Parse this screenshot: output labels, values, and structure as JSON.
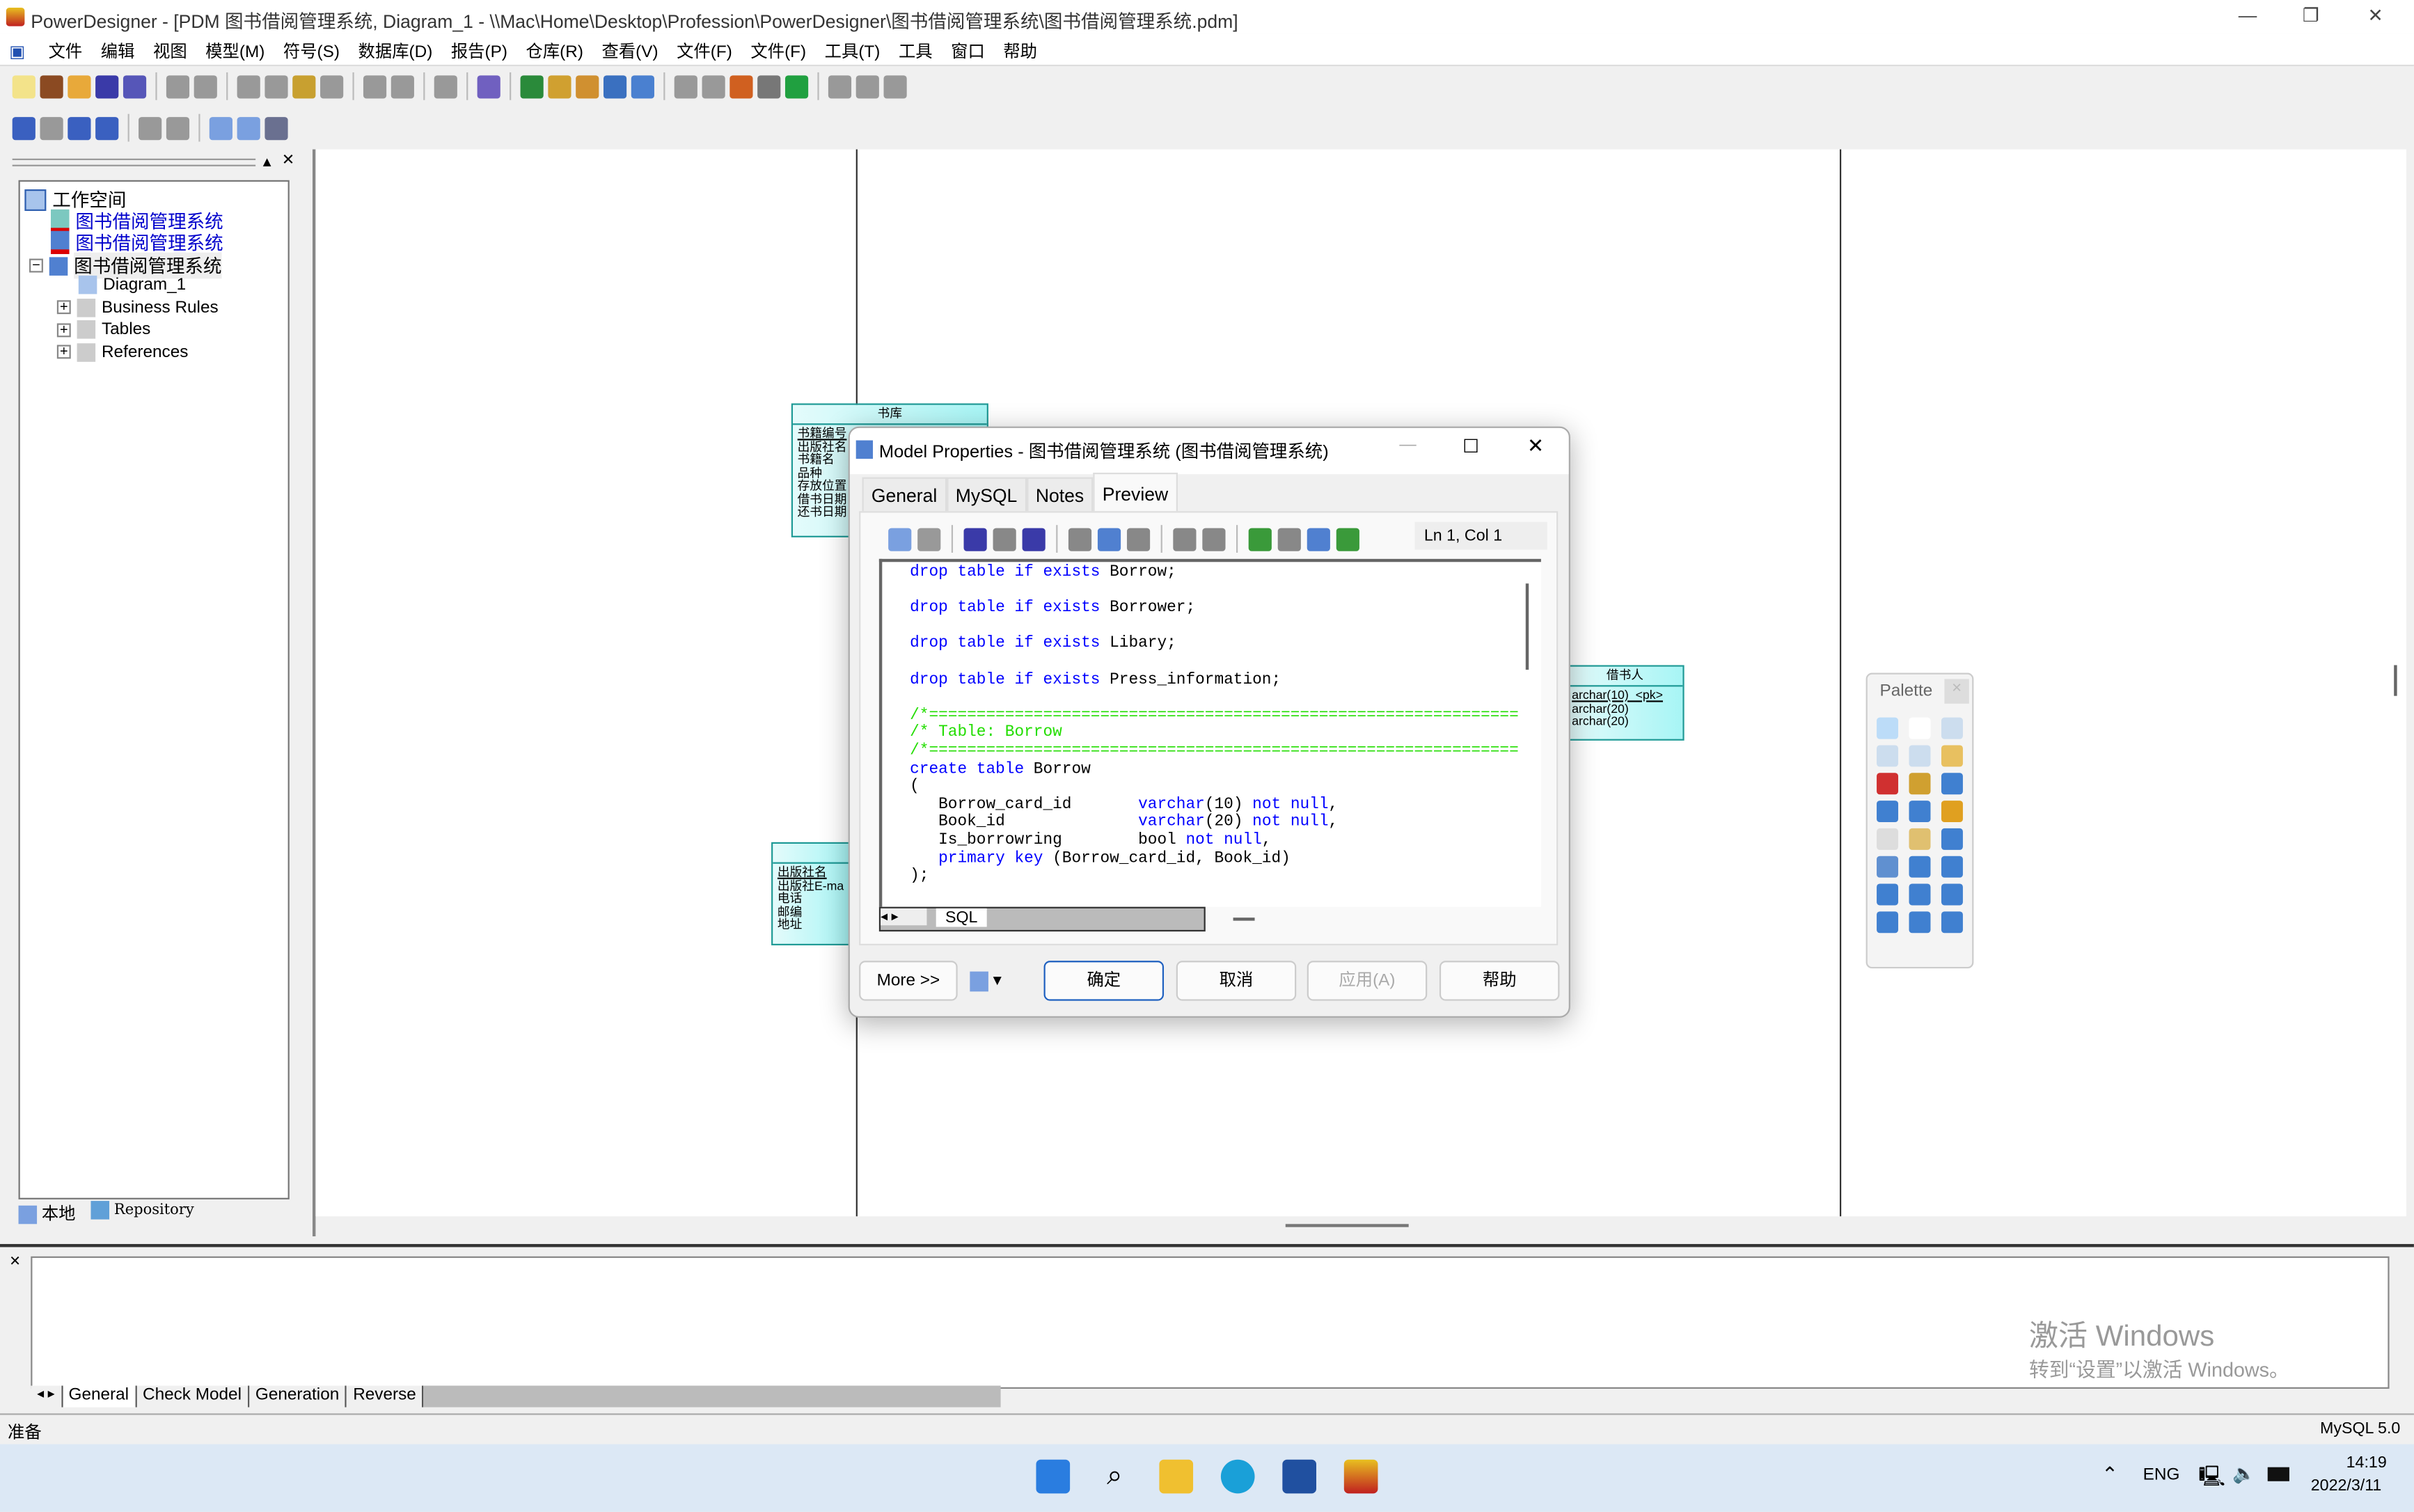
{
  "app": {
    "title": "PowerDesigner - [PDM 图书借阅管理系统, Diagram_1 - \\\\Mac\\Home\\Desktop\\Profession\\PowerDesigner\\图书借阅管理系统\\图书借阅管理系统.pdm]",
    "minimize": "—",
    "maximize": "❐",
    "close": "✕"
  },
  "menu": [
    "文件",
    "编辑",
    "视图",
    "模型(M)",
    "符号(S)",
    "数据库(D)",
    "报告(P)",
    "仓库(R)",
    "查看(V)",
    "文件(F)",
    "文件(F)",
    "工具(T)",
    "工具",
    "窗口",
    "帮助"
  ],
  "toolbar1": [
    [
      "new-icon",
      "#f3e38a"
    ],
    [
      "new-project-icon",
      "#8b4a22"
    ],
    [
      "open-icon",
      "#e8a93a"
    ],
    [
      "save-icon",
      "#3a3aa8"
    ],
    [
      "save-all-icon",
      "#5656b8"
    ],
    "|",
    [
      "print-preview-icon",
      "#999"
    ],
    [
      "print-icon",
      "#999"
    ],
    "|",
    [
      "cut-icon",
      "#999"
    ],
    [
      "copy-icon",
      "#999"
    ],
    [
      "paste-icon",
      "#c8a030"
    ],
    [
      "delete-icon",
      "#999"
    ],
    "|",
    [
      "undo-icon",
      "#999"
    ],
    [
      "redo-icon",
      "#999"
    ],
    "|",
    [
      "properties-icon",
      "#999"
    ],
    "|",
    [
      "check-model-icon",
      "#7060c0"
    ],
    "|",
    [
      "generate-database-icon",
      "#2a8a3a"
    ],
    [
      "reverse-engineer-icon",
      "#d0a030"
    ],
    [
      "repository-icon",
      "#d09030"
    ],
    [
      "update-icon",
      "#3a70c0"
    ],
    [
      "check-icon",
      "#4a80d0"
    ],
    "|",
    [
      "group-icon",
      "#999"
    ],
    [
      "ungroup-icon",
      "#999"
    ],
    [
      "pen-icon",
      "#d06020"
    ],
    [
      "fill-icon",
      "#777"
    ],
    [
      "font-icon",
      "#20a040"
    ],
    "|",
    [
      "bring-front-icon",
      "#999"
    ],
    [
      "back-icon",
      "#999"
    ],
    [
      "forward-icon",
      "#999"
    ]
  ],
  "toolbar2": [
    [
      "diagram-icon",
      "#3a60c0"
    ],
    [
      "package-icon",
      "#999"
    ],
    [
      "list-icon",
      "#3a60c0"
    ],
    [
      "compare-icon",
      "#3a60c0"
    ],
    "|",
    [
      "toolbar-a-icon",
      "#999"
    ],
    [
      "toolbar-b-icon",
      "#999"
    ],
    "|",
    [
      "browser-icon",
      "#7aa0e0"
    ],
    [
      "output-icon",
      "#7aa0e0"
    ],
    [
      "result-list-icon",
      "#6a7090"
    ]
  ],
  "tree": {
    "root": "工作空间",
    "items": [
      {
        "label": "图书借阅管理系统",
        "color": "#0000cc"
      },
      {
        "label": "图书借阅管理系统",
        "color": "#0000cc"
      },
      {
        "label": "图书借阅管理系统",
        "color": "#000000"
      }
    ],
    "children": [
      "Diagram_1",
      "Business Rules",
      "Tables",
      "References"
    ]
  },
  "left_tabs": [
    "本地",
    "Repository"
  ],
  "entities": {
    "library": {
      "title": "书库",
      "fields": [
        "书籍编号",
        "出版社名",
        "书籍名",
        "品种",
        "存放位置",
        "借书日期",
        "还书日期"
      ]
    },
    "press": {
      "title": "",
      "fields": [
        "出版社名",
        "出版社E-ma",
        "电话",
        "邮编",
        "地址"
      ]
    },
    "borrower": {
      "title": "借书人",
      "fields": [
        "archar(10)  <pk>",
        "archar(20)",
        "archar(20)"
      ]
    }
  },
  "palette": {
    "title": "Palette",
    "close": "×",
    "tools": [
      "pointer-icon",
      "hand-icon",
      "zoom-in-icon",
      "zoom-out-icon",
      "zoom-icon",
      "open-package-icon",
      "cut-tool-icon",
      "properties-tool-icon",
      "table-tool-icon",
      "view-tool-icon",
      "reference-tool-icon",
      "procedure-tool-icon",
      "file-tool-icon",
      "note-tool-icon",
      "link-tool-icon",
      "package-tool-icon",
      "title-tool-icon",
      "line-tool-icon",
      "arc-tool-icon",
      "rectangle-tool-icon",
      "ellipse-tool-icon",
      "rounded-rect-tool-icon",
      "polyline-tool-icon",
      "polygon-tool-icon"
    ]
  },
  "dialog": {
    "title": "Model Properties - 图书借阅管理系统 (图书借阅管理系统)",
    "tabs": [
      "General",
      "MySQL",
      "Notes",
      "Preview"
    ],
    "active_tab": "Preview",
    "cursor_pos": "Ln 1, Col 1",
    "editor_tab": "SQL",
    "code": [
      [
        [
          "kw",
          "drop table if exists "
        ],
        [
          "t",
          "Borrow;"
        ]
      ],
      [],
      [
        [
          "kw",
          "drop table if exists "
        ],
        [
          "t",
          "Borrower;"
        ]
      ],
      [],
      [
        [
          "kw",
          "drop table if exists "
        ],
        [
          "t",
          "Libary;"
        ]
      ],
      [],
      [
        [
          "kw",
          "drop table if exists "
        ],
        [
          "t",
          "Press_information;"
        ]
      ],
      [],
      [
        [
          "cm",
          "/*=============================================================="
        ]
      ],
      [
        [
          "cm",
          "/* Table: Borrow"
        ]
      ],
      [
        [
          "cm",
          "/*=============================================================="
        ]
      ],
      [
        [
          "kw",
          "create table "
        ],
        [
          "t",
          "Borrow"
        ]
      ],
      [
        [
          "t",
          "("
        ]
      ],
      [
        [
          "t",
          "   Borrow_card_id       "
        ],
        [
          "kw",
          "varchar"
        ],
        [
          "t",
          "(10) "
        ],
        [
          "kw",
          "not null"
        ],
        [
          "t",
          ","
        ]
      ],
      [
        [
          "t",
          "   Book_id              "
        ],
        [
          "kw",
          "varchar"
        ],
        [
          "t",
          "(20) "
        ],
        [
          "kw",
          "not null"
        ],
        [
          "t",
          ","
        ]
      ],
      [
        [
          "t",
          "   Is_borrowring        bool "
        ],
        [
          "kw",
          "not null"
        ],
        [
          "t",
          ","
        ]
      ],
      [
        [
          "kw",
          "   primary key "
        ],
        [
          "t",
          "(Borrow_card_id, Book_id)"
        ]
      ],
      [
        [
          "t",
          ");"
        ]
      ]
    ],
    "buttons": {
      "more": "More >>",
      "ok": "确定",
      "cancel": "取消",
      "apply": "应用(A)",
      "help": "帮助"
    }
  },
  "output": {
    "tabs": [
      "General",
      "Check Model",
      "Generation",
      "Reverse"
    ]
  },
  "watermark": {
    "line1": "激活 Windows",
    "line2": "转到“设置”以激活 Windows。"
  },
  "status": {
    "left": "准备",
    "right": "MySQL 5.0"
  },
  "taskbar": {
    "lang": "ENG",
    "time": "14:19",
    "date": "2022/3/11"
  }
}
